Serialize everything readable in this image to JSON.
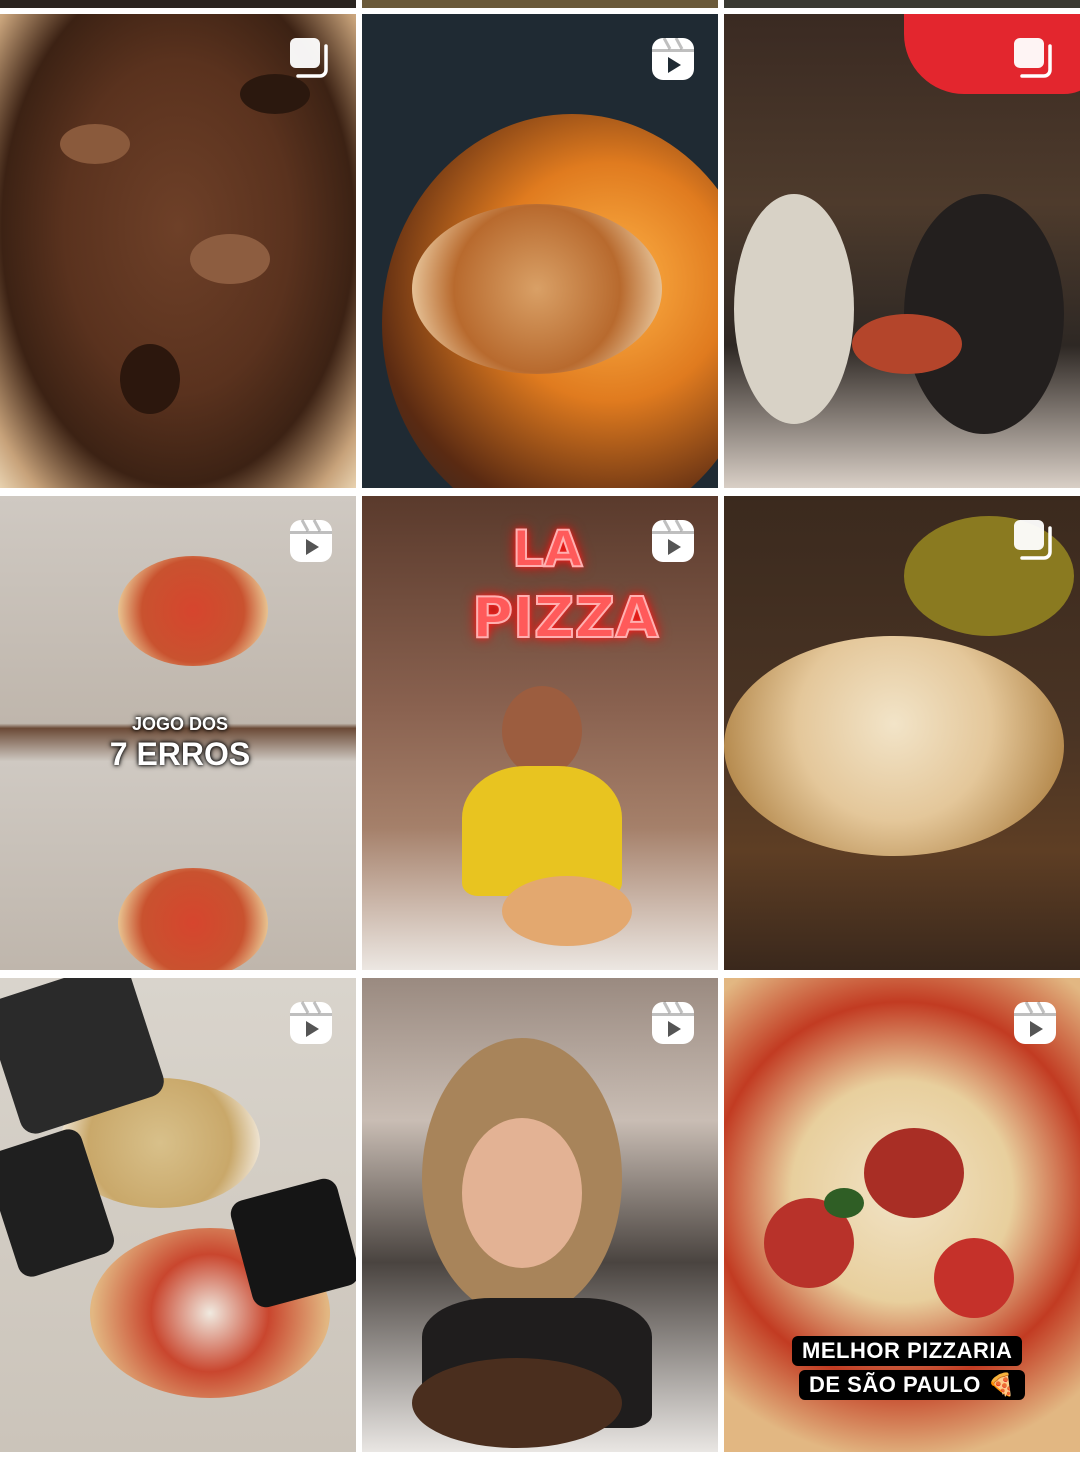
{
  "icons": {
    "reel": "reels-icon",
    "carousel": "carousel-icon"
  },
  "posts": [
    {
      "id": "post-1",
      "badge": "carousel",
      "captions": []
    },
    {
      "id": "post-2",
      "badge": "reel",
      "captions": []
    },
    {
      "id": "post-3",
      "badge": "carousel",
      "captions": []
    },
    {
      "id": "post-4",
      "badge": "reel",
      "captions": [
        "JOGO DOS",
        "7 ERROS"
      ]
    },
    {
      "id": "post-5",
      "badge": "reel",
      "captions": [
        "LA",
        "PIZZA"
      ]
    },
    {
      "id": "post-6",
      "badge": "carousel",
      "captions": []
    },
    {
      "id": "post-7",
      "badge": "reel",
      "captions": []
    },
    {
      "id": "post-8",
      "badge": "reel",
      "captions": []
    },
    {
      "id": "post-9",
      "badge": "reel",
      "captions": [
        "MELHOR PIZZARIA",
        "DE SÃO PAULO 🍕"
      ]
    }
  ],
  "colors": {
    "badge": "#ffffff",
    "background": "#ffffff"
  }
}
